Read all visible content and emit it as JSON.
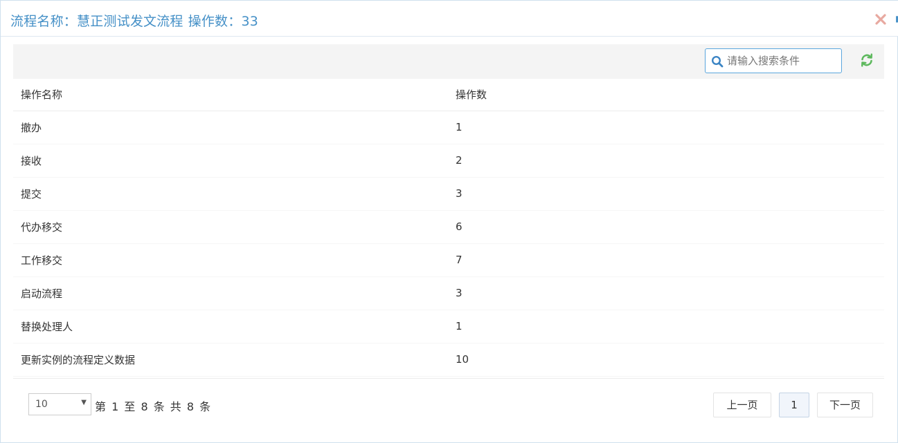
{
  "dialog": {
    "title_label": "流程名称：",
    "flow_name": "慧正测试发文流程",
    "op_count_label": "操作数：",
    "op_count": "33"
  },
  "search": {
    "placeholder": "请输入搜索条件"
  },
  "table": {
    "headers": [
      "操作名称",
      "操作数"
    ],
    "rows": [
      {
        "name": "撤办",
        "count": "1"
      },
      {
        "name": "接收",
        "count": "2"
      },
      {
        "name": "提交",
        "count": "3"
      },
      {
        "name": "代办移交",
        "count": "6"
      },
      {
        "name": "工作移交",
        "count": "7"
      },
      {
        "name": "启动流程",
        "count": "3"
      },
      {
        "name": "替换处理人",
        "count": "1"
      },
      {
        "name": "更新实例的流程定义数据",
        "count": "10"
      }
    ]
  },
  "pagination": {
    "page_size": "10",
    "info": "第 1 至 8 条 共 8 条",
    "prev_label": "上一页",
    "current_page": "1",
    "next_label": "下一页"
  },
  "colors": {
    "title": "#4590c7",
    "accent_border": "#5aa6dd",
    "refresh": "#5cb85c",
    "close": "#e8a9a0"
  },
  "icons": [
    "close-icon",
    "search-icon",
    "refresh-icon",
    "caret-down-icon"
  ]
}
